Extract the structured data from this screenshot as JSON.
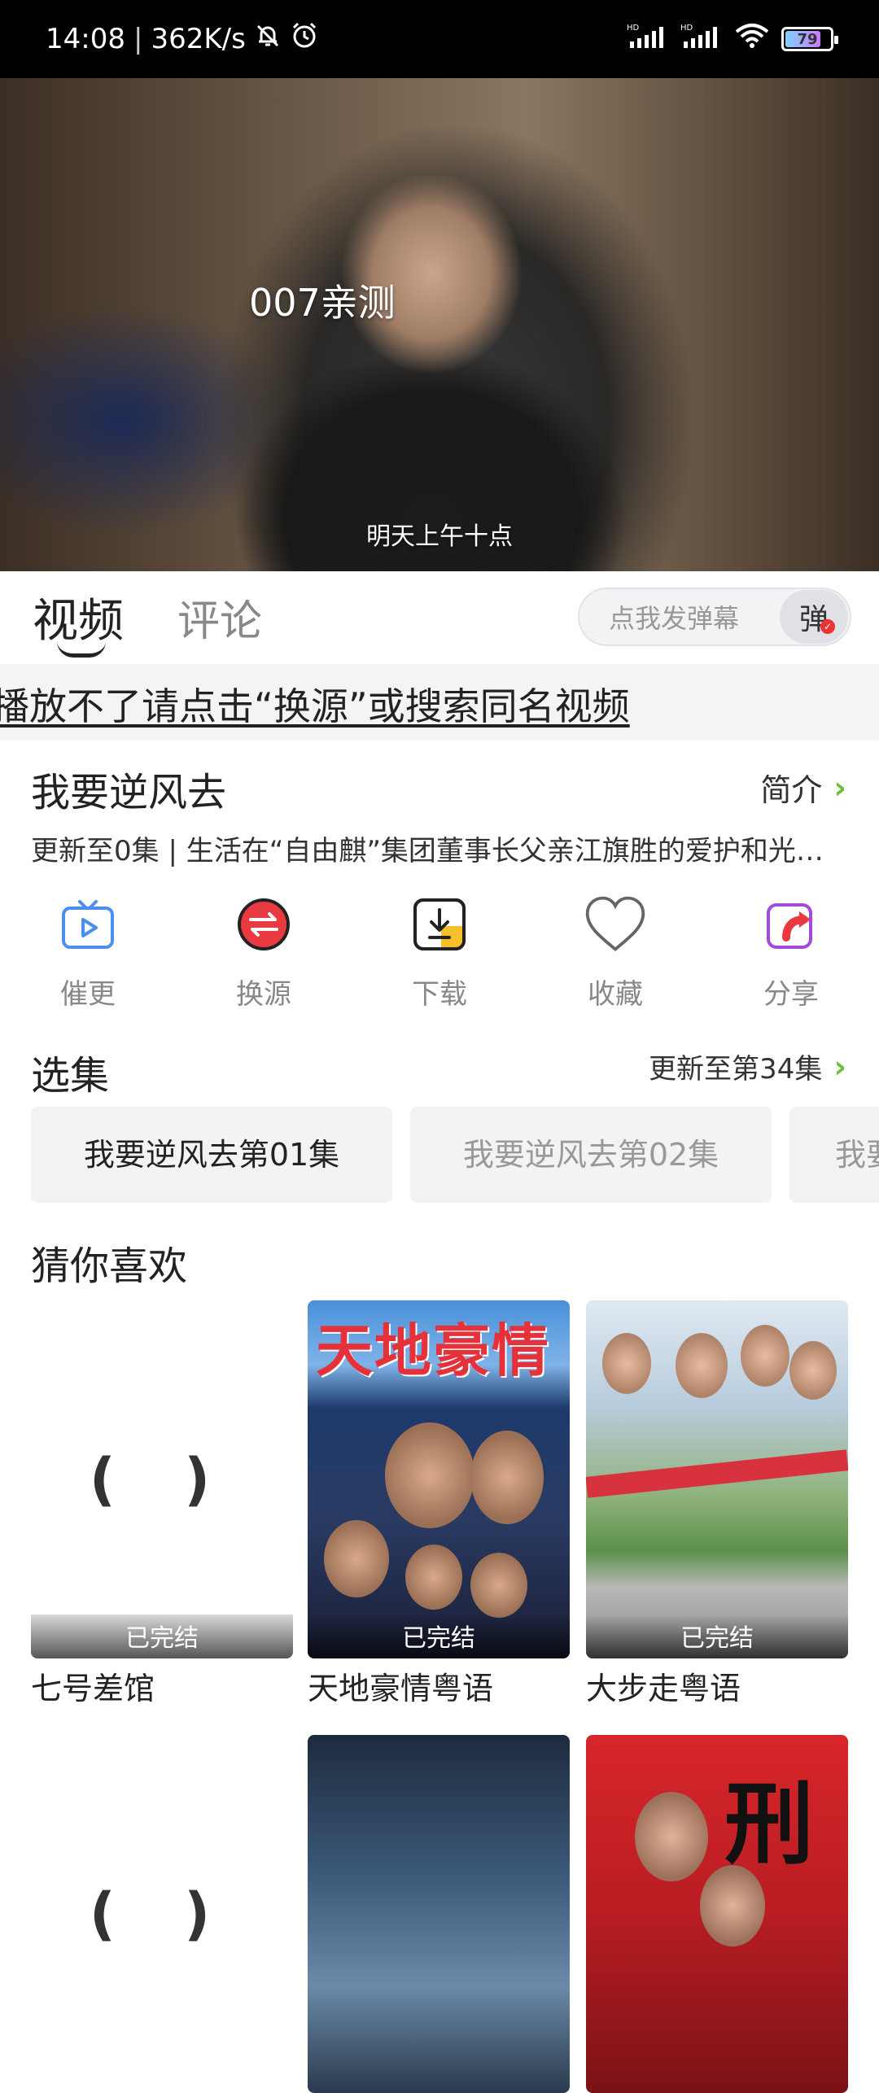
{
  "status_bar": {
    "time": "14:08",
    "speed": "362K/s",
    "network_1": "HD",
    "network_2": "HD",
    "battery": "79"
  },
  "video": {
    "watermark": "007亲测",
    "subtitle": "明天上午十点"
  },
  "tabs": [
    {
      "label": "视频",
      "active": true
    },
    {
      "label": "评论",
      "active": false
    }
  ],
  "danmu": {
    "placeholder": "点我发弹幕",
    "button": "弹"
  },
  "notice": "播放不了请点击“换源”或搜索同名视频",
  "show": {
    "title": "我要逆风去",
    "intro_label": "简介",
    "description": "更新至0集 | 生活在“自由麒”集团董事长父亲江旗胜的爱护和光…"
  },
  "actions": [
    {
      "label": "催更",
      "icon": "tv-play-icon"
    },
    {
      "label": "换源",
      "icon": "switch-source-icon"
    },
    {
      "label": "下载",
      "icon": "download-icon"
    },
    {
      "label": "收藏",
      "icon": "heart-icon"
    },
    {
      "label": "分享",
      "icon": "share-icon"
    }
  ],
  "episodes": {
    "section_title": "选集",
    "update_label": "更新至第34集",
    "items": [
      "我要逆风去第01集",
      "我要逆风去第02集",
      "我要"
    ]
  },
  "recommend": {
    "section_title": "猜你喜欢",
    "items": [
      {
        "name": "七号差馆",
        "tag": "已完结",
        "loading": "( )"
      },
      {
        "name": "天地豪情粤语",
        "tag": "已完结",
        "poster_title": "天地豪情"
      },
      {
        "name": "大步走粤语",
        "tag": "已完结"
      },
      {
        "name": "",
        "tag": "",
        "loading": "( )"
      },
      {
        "name": "",
        "tag": ""
      },
      {
        "name": "",
        "tag": "",
        "poster_title": "刑"
      }
    ]
  },
  "colors": {
    "accent_green": "#6bbf3a",
    "danmu_dot": "#e33333"
  }
}
